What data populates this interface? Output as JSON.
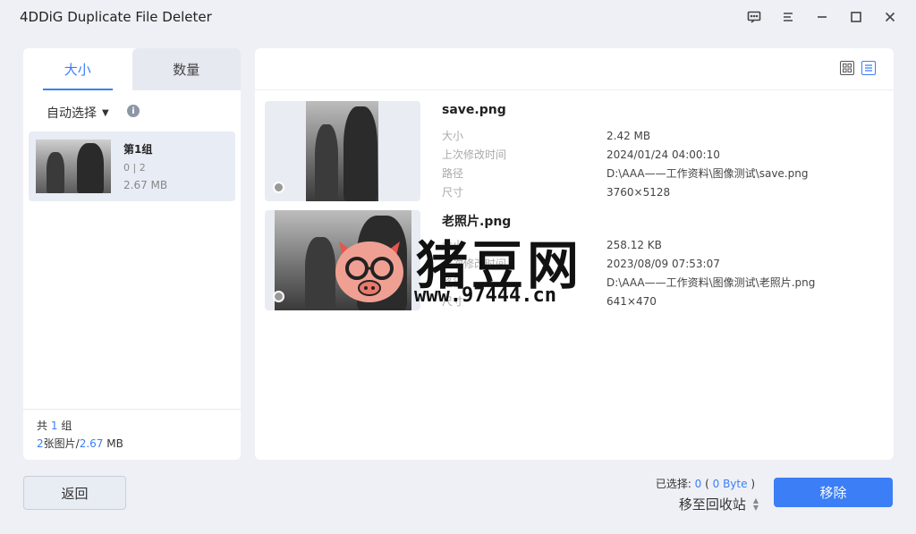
{
  "app": {
    "title": "4DDiG Duplicate File Deleter"
  },
  "left": {
    "tabs": [
      {
        "label": "大小"
      },
      {
        "label": "数量"
      }
    ],
    "auto_select": "自动选择",
    "group": {
      "name": "第1组",
      "count": "0 | 2",
      "size": "2.67 MB"
    },
    "footer": {
      "line1_prefix": "共",
      "groups": "1",
      "line1_suffix": "组",
      "images": "2",
      "images_label": "张图片/",
      "total_size": "2.67",
      "size_unit": " MB"
    }
  },
  "files": [
    {
      "name": "save.png",
      "meta": [
        {
          "k": "大小",
          "v": "2.42 MB"
        },
        {
          "k": "上次修改时间",
          "v": "2024/01/24 04:00:10"
        },
        {
          "k": "路径",
          "v": "D:\\AAA——工作资料\\图像测试\\save.png"
        },
        {
          "k": "尺寸",
          "v": "3760×5128"
        }
      ]
    },
    {
      "name": "老照片.png",
      "meta": [
        {
          "k": "大小",
          "v": "258.12 KB"
        },
        {
          "k": "上次修改时间",
          "v": "2023/08/09 07:53:07"
        },
        {
          "k": "路径",
          "v": "D:\\AAA——工作资料\\图像测试\\老照片.png"
        },
        {
          "k": "尺寸",
          "v": "641×470"
        }
      ]
    }
  ],
  "watermark": {
    "text": "猪豆网",
    "url": "www.97444.cn"
  },
  "bottom": {
    "back_label": "返回",
    "selected_prefix": "已选择: ",
    "selected_count": "0",
    "selected_bytes": "0 Byte",
    "recycle_label": "移至回收站",
    "remove_label": "移除"
  },
  "colors": {
    "accent": "#3b7ef6"
  }
}
